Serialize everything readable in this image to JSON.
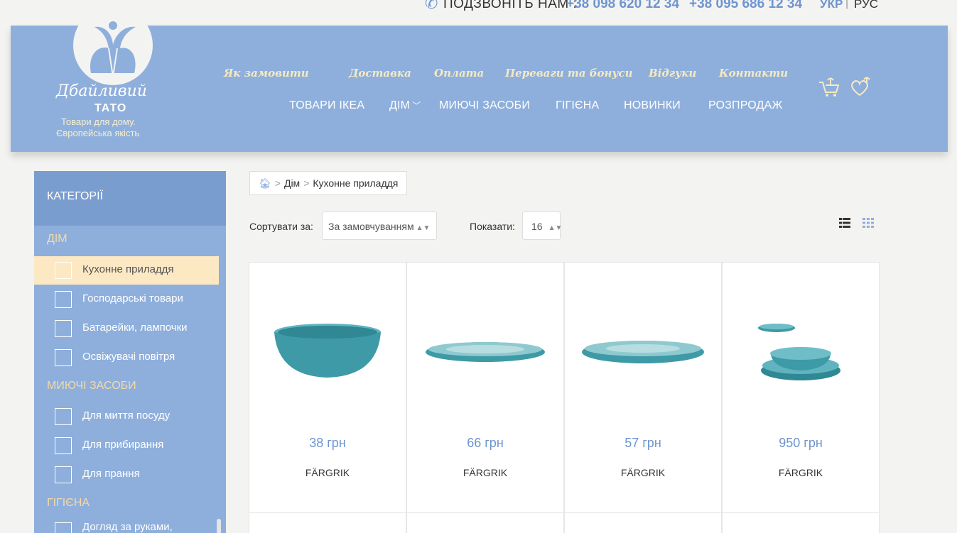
{
  "topbar": {
    "call_label": "ПОДЗВОНІТЬ НАМ :",
    "phone1": "+38 098 620 12 34",
    "phone2": "+38 095 686 12 34",
    "lang_active": "УКР",
    "lang_sep": "|",
    "lang_other": "РУС"
  },
  "logo": {
    "script": "Дбайливий",
    "tato": "ТАТО",
    "tagline1": "Товари для дому.",
    "tagline2": "Європейська якість"
  },
  "infolinks": [
    "Як замовити",
    "Доставка",
    "Оплата",
    "Переваги та бонуси",
    "Відгуки",
    "Контакти"
  ],
  "catnav": [
    "ТОВАРИ ІКЕА",
    "ДІМ",
    "МИЮЧІ ЗАСОБИ",
    "ГІГІЄНА",
    "НОВИНКИ",
    "РОЗПРОДАЖ"
  ],
  "sidebar": {
    "title": "КАТЕГОРІЇ",
    "sections": [
      {
        "label": "ДІМ",
        "items": [
          "Кухонне приладдя",
          "Господарські товари",
          "Батарейки, лампочки",
          "Освіжувачі повітря"
        ]
      },
      {
        "label": "МИЮЧІ ЗАСОБИ",
        "items": [
          "Для миття посуду",
          "Для прибирання",
          "Для прання"
        ]
      },
      {
        "label": "ГІГІЄНА",
        "items": [
          "Догляд за руками,"
        ]
      }
    ],
    "active_item": "Кухонне приладдя"
  },
  "breadcrumb": {
    "sep": ">",
    "items": [
      "Дім",
      "Кухонне приладдя"
    ]
  },
  "sort": {
    "label": "Сортувати за:",
    "value": "За замовчуванням"
  },
  "show": {
    "label": "Показати:",
    "value": "16"
  },
  "products": [
    {
      "price": "38 грн",
      "name": "FÄRGRIK",
      "image": "teal-bowl"
    },
    {
      "price": "66 грн",
      "name": "FÄRGRIK",
      "image": "teal-plate"
    },
    {
      "price": "57 грн",
      "name": "FÄRGRIK",
      "image": "teal-plate-wide"
    },
    {
      "price": "950 грн",
      "name": "FÄRGRIK",
      "image": "teal-dinner-set"
    }
  ],
  "colors": {
    "header": "#8eafdc",
    "accent": "#6e95cf",
    "active_item": "#fce8c3",
    "product": "#4aa3ae"
  }
}
